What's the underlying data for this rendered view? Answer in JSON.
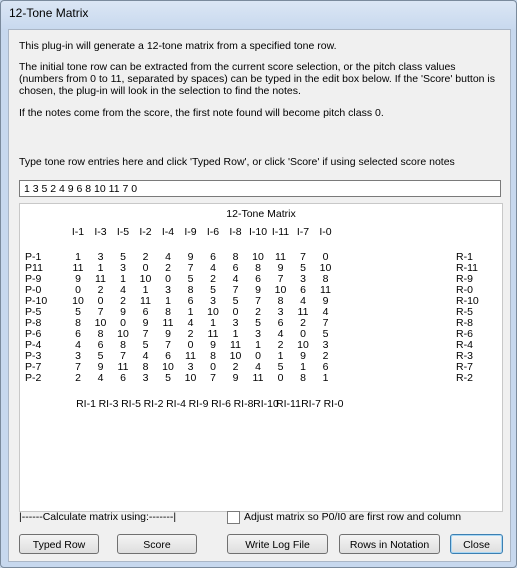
{
  "window": {
    "title": "12-Tone Matrix"
  },
  "description": {
    "line1": "This plug-in will generate a 12-tone matrix from a specified tone row.",
    "line2a": "The initial tone row can be extracted from the current score selection, or the pitch class values",
    "line2b": "(numbers from 0 to 11, separated by spaces) can be typed in the edit box below. If the 'Score' button is",
    "line2c": "chosen, the plug-in will look in the selection to find the notes.",
    "line3": "If the notes come from the score, the first note found will become pitch class 0.",
    "line4": "Type tone row entries here and click 'Typed Row', or click 'Score' if using selected score notes"
  },
  "tone_row_input": {
    "value": "1 3 5 2 4 9 6 8 10 11 7 0"
  },
  "matrix": {
    "title": "12-Tone Matrix",
    "col_headers": [
      "I-1",
      "I-3",
      "I-5",
      "I-2",
      "I-4",
      "I-9",
      "I-6",
      "I-8",
      "I-10",
      "I-11",
      "I-7",
      "I-0"
    ],
    "footer_labels": [
      "RI-1",
      "RI-3",
      "RI-5",
      "RI-2",
      "RI-4",
      "RI-9",
      "RI-6",
      "RI-8",
      "RI-10",
      "RI-11",
      "RI-7",
      "RI-0"
    ],
    "rows": [
      {
        "p": "P-1",
        "r": "R-1",
        "vals": [
          "1",
          "3",
          "5",
          "2",
          "4",
          "9",
          "6",
          "8",
          "10",
          "11",
          "7",
          "0"
        ]
      },
      {
        "p": "P11",
        "r": "R-11",
        "vals": [
          "11",
          "1",
          "3",
          "0",
          "2",
          "7",
          "4",
          "6",
          "8",
          "9",
          "5",
          "10"
        ]
      },
      {
        "p": "P-9",
        "r": "R-9",
        "vals": [
          "9",
          "11",
          "1",
          "10",
          "0",
          "5",
          "2",
          "4",
          "6",
          "7",
          "3",
          "8"
        ]
      },
      {
        "p": "P-0",
        "r": "R-0",
        "vals": [
          "0",
          "2",
          "4",
          "1",
          "3",
          "8",
          "5",
          "7",
          "9",
          "10",
          "6",
          "11"
        ]
      },
      {
        "p": "P-10",
        "r": "R-10",
        "vals": [
          "10",
          "0",
          "2",
          "11",
          "1",
          "6",
          "3",
          "5",
          "7",
          "8",
          "4",
          "9"
        ]
      },
      {
        "p": "P-5",
        "r": "R-5",
        "vals": [
          "5",
          "7",
          "9",
          "6",
          "8",
          "1",
          "10",
          "0",
          "2",
          "3",
          "11",
          "4"
        ]
      },
      {
        "p": "P-8",
        "r": "R-8",
        "vals": [
          "8",
          "10",
          "0",
          "9",
          "11",
          "4",
          "1",
          "3",
          "5",
          "6",
          "2",
          "7"
        ]
      },
      {
        "p": "P-6",
        "r": "R-6",
        "vals": [
          "6",
          "8",
          "10",
          "7",
          "9",
          "2",
          "11",
          "1",
          "3",
          "4",
          "0",
          "5"
        ]
      },
      {
        "p": "P-4",
        "r": "R-4",
        "vals": [
          "4",
          "6",
          "8",
          "5",
          "7",
          "0",
          "9",
          "11",
          "1",
          "2",
          "10",
          "3"
        ]
      },
      {
        "p": "P-3",
        "r": "R-3",
        "vals": [
          "3",
          "5",
          "7",
          "4",
          "6",
          "11",
          "8",
          "10",
          "0",
          "1",
          "9",
          "2"
        ]
      },
      {
        "p": "P-7",
        "r": "R-7",
        "vals": [
          "7",
          "9",
          "11",
          "8",
          "10",
          "3",
          "0",
          "2",
          "4",
          "5",
          "1",
          "6"
        ]
      },
      {
        "p": "P-2",
        "r": "R-2",
        "vals": [
          "2",
          "4",
          "6",
          "3",
          "5",
          "10",
          "7",
          "9",
          "11",
          "0",
          "8",
          "1"
        ]
      }
    ]
  },
  "calc_label": "|------Calculate matrix using:-------|",
  "adjust_checkbox": {
    "label": "Adjust matrix so P0/I0 are first row and column",
    "checked": false
  },
  "buttons": {
    "typed_row": "Typed Row",
    "score": "Score",
    "write_log": "Write Log File",
    "rows_in_notation": "Rows in Notation",
    "close": "Close"
  }
}
